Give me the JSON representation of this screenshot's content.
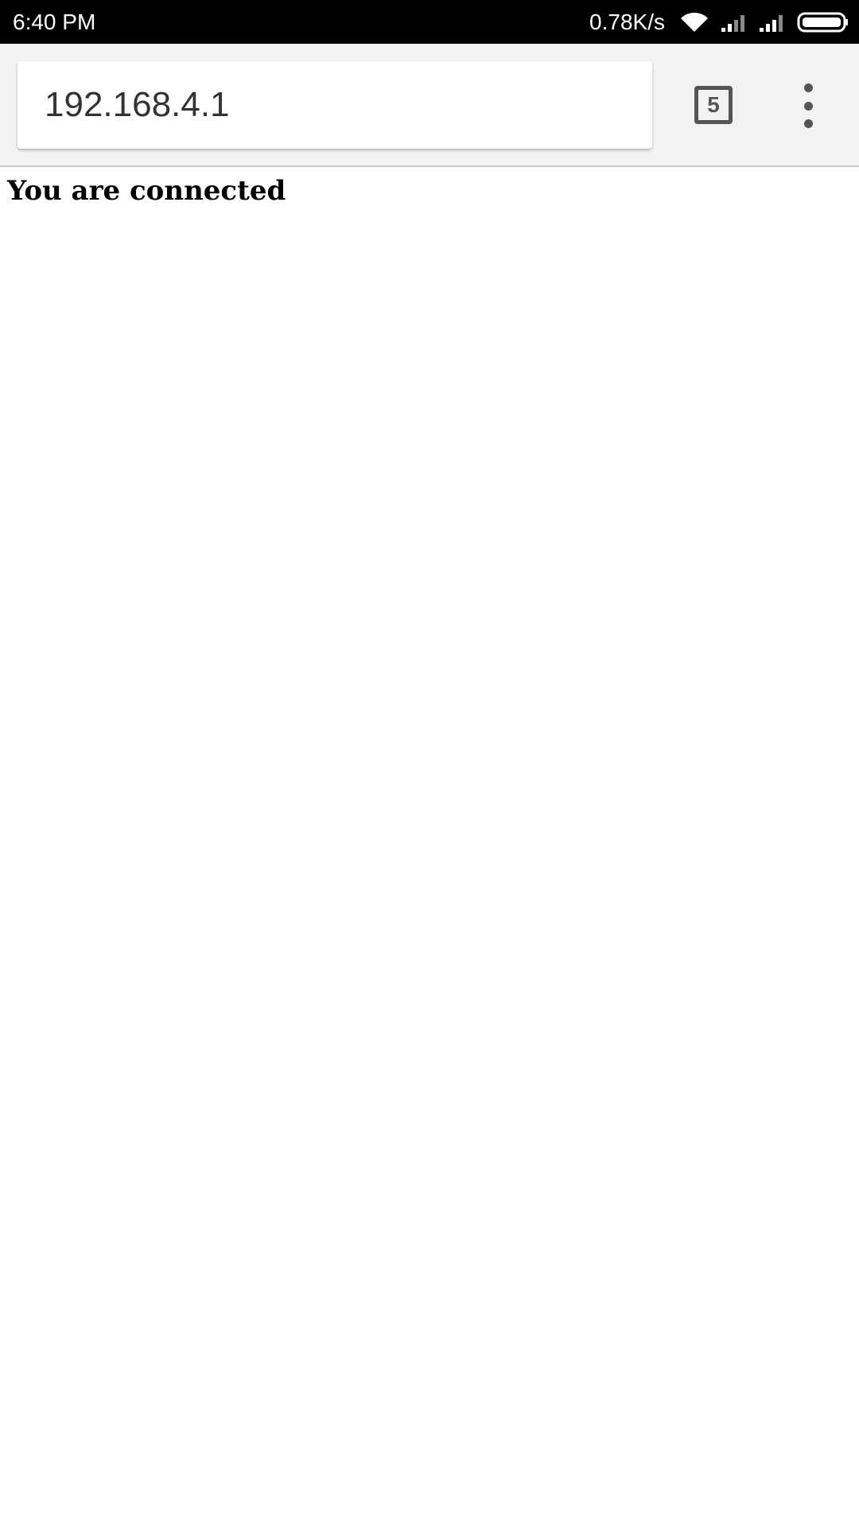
{
  "status_bar": {
    "time": "6:40 PM",
    "net_speed": "0.78K/s",
    "icons": [
      "wifi-icon",
      "signal-icon",
      "signal-icon",
      "battery-icon"
    ]
  },
  "browser": {
    "url": "192.168.4.1",
    "tab_count": "5",
    "menu_icon": "more-vert-icon"
  },
  "page": {
    "heading": "You are connected"
  },
  "colors": {
    "status_bar_bg": "#000000",
    "toolbar_bg": "#f2f2f2",
    "icon_gray": "#555555"
  }
}
